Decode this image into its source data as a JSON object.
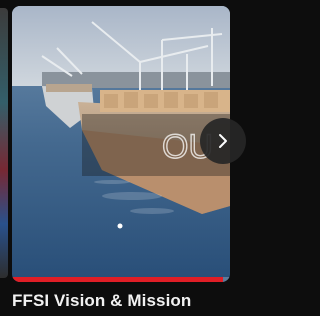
{
  "video": {
    "title": "FFSI Vision & Mission",
    "progress_fraction": 0.97,
    "progress_color": "#e01e26",
    "overlay_text": "OU"
  },
  "controls": {
    "next_icon": "chevron-right-icon",
    "left_neighbor": "previous-thumbnail-edge"
  }
}
